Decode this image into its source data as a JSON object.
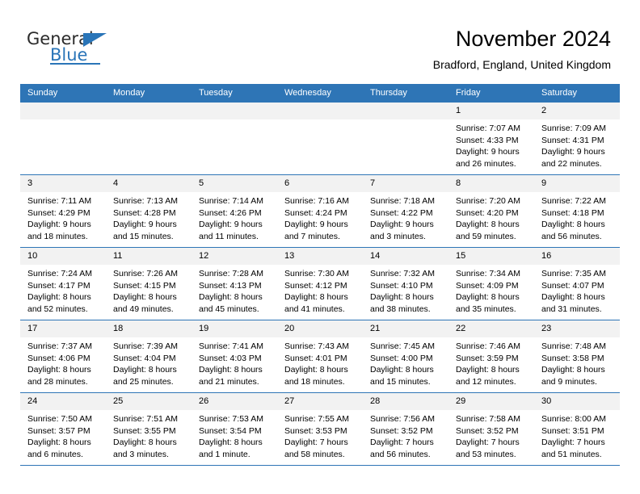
{
  "brand": {
    "name_top": "General",
    "name_bottom": "Blue",
    "accent_color": "#2a75b8"
  },
  "header": {
    "title": "November 2024",
    "subtitle": "Bradford, England, United Kingdom"
  },
  "calendar": {
    "header_bg": "#2e75b6",
    "daynum_bg": "#f2f2f2",
    "weekday_headers": [
      "Sunday",
      "Monday",
      "Tuesday",
      "Wednesday",
      "Thursday",
      "Friday",
      "Saturday"
    ],
    "weeks": [
      [
        {
          "day": "",
          "empty": true
        },
        {
          "day": "",
          "empty": true
        },
        {
          "day": "",
          "empty": true
        },
        {
          "day": "",
          "empty": true
        },
        {
          "day": "",
          "empty": true
        },
        {
          "day": "1",
          "sunrise": "Sunrise: 7:07 AM",
          "sunset": "Sunset: 4:33 PM",
          "daylight": "Daylight: 9 hours and 26 minutes."
        },
        {
          "day": "2",
          "sunrise": "Sunrise: 7:09 AM",
          "sunset": "Sunset: 4:31 PM",
          "daylight": "Daylight: 9 hours and 22 minutes."
        }
      ],
      [
        {
          "day": "3",
          "sunrise": "Sunrise: 7:11 AM",
          "sunset": "Sunset: 4:29 PM",
          "daylight": "Daylight: 9 hours and 18 minutes."
        },
        {
          "day": "4",
          "sunrise": "Sunrise: 7:13 AM",
          "sunset": "Sunset: 4:28 PM",
          "daylight": "Daylight: 9 hours and 15 minutes."
        },
        {
          "day": "5",
          "sunrise": "Sunrise: 7:14 AM",
          "sunset": "Sunset: 4:26 PM",
          "daylight": "Daylight: 9 hours and 11 minutes."
        },
        {
          "day": "6",
          "sunrise": "Sunrise: 7:16 AM",
          "sunset": "Sunset: 4:24 PM",
          "daylight": "Daylight: 9 hours and 7 minutes."
        },
        {
          "day": "7",
          "sunrise": "Sunrise: 7:18 AM",
          "sunset": "Sunset: 4:22 PM",
          "daylight": "Daylight: 9 hours and 3 minutes."
        },
        {
          "day": "8",
          "sunrise": "Sunrise: 7:20 AM",
          "sunset": "Sunset: 4:20 PM",
          "daylight": "Daylight: 8 hours and 59 minutes."
        },
        {
          "day": "9",
          "sunrise": "Sunrise: 7:22 AM",
          "sunset": "Sunset: 4:18 PM",
          "daylight": "Daylight: 8 hours and 56 minutes."
        }
      ],
      [
        {
          "day": "10",
          "sunrise": "Sunrise: 7:24 AM",
          "sunset": "Sunset: 4:17 PM",
          "daylight": "Daylight: 8 hours and 52 minutes."
        },
        {
          "day": "11",
          "sunrise": "Sunrise: 7:26 AM",
          "sunset": "Sunset: 4:15 PM",
          "daylight": "Daylight: 8 hours and 49 minutes."
        },
        {
          "day": "12",
          "sunrise": "Sunrise: 7:28 AM",
          "sunset": "Sunset: 4:13 PM",
          "daylight": "Daylight: 8 hours and 45 minutes."
        },
        {
          "day": "13",
          "sunrise": "Sunrise: 7:30 AM",
          "sunset": "Sunset: 4:12 PM",
          "daylight": "Daylight: 8 hours and 41 minutes."
        },
        {
          "day": "14",
          "sunrise": "Sunrise: 7:32 AM",
          "sunset": "Sunset: 4:10 PM",
          "daylight": "Daylight: 8 hours and 38 minutes."
        },
        {
          "day": "15",
          "sunrise": "Sunrise: 7:34 AM",
          "sunset": "Sunset: 4:09 PM",
          "daylight": "Daylight: 8 hours and 35 minutes."
        },
        {
          "day": "16",
          "sunrise": "Sunrise: 7:35 AM",
          "sunset": "Sunset: 4:07 PM",
          "daylight": "Daylight: 8 hours and 31 minutes."
        }
      ],
      [
        {
          "day": "17",
          "sunrise": "Sunrise: 7:37 AM",
          "sunset": "Sunset: 4:06 PM",
          "daylight": "Daylight: 8 hours and 28 minutes."
        },
        {
          "day": "18",
          "sunrise": "Sunrise: 7:39 AM",
          "sunset": "Sunset: 4:04 PM",
          "daylight": "Daylight: 8 hours and 25 minutes."
        },
        {
          "day": "19",
          "sunrise": "Sunrise: 7:41 AM",
          "sunset": "Sunset: 4:03 PM",
          "daylight": "Daylight: 8 hours and 21 minutes."
        },
        {
          "day": "20",
          "sunrise": "Sunrise: 7:43 AM",
          "sunset": "Sunset: 4:01 PM",
          "daylight": "Daylight: 8 hours and 18 minutes."
        },
        {
          "day": "21",
          "sunrise": "Sunrise: 7:45 AM",
          "sunset": "Sunset: 4:00 PM",
          "daylight": "Daylight: 8 hours and 15 minutes."
        },
        {
          "day": "22",
          "sunrise": "Sunrise: 7:46 AM",
          "sunset": "Sunset: 3:59 PM",
          "daylight": "Daylight: 8 hours and 12 minutes."
        },
        {
          "day": "23",
          "sunrise": "Sunrise: 7:48 AM",
          "sunset": "Sunset: 3:58 PM",
          "daylight": "Daylight: 8 hours and 9 minutes."
        }
      ],
      [
        {
          "day": "24",
          "sunrise": "Sunrise: 7:50 AM",
          "sunset": "Sunset: 3:57 PM",
          "daylight": "Daylight: 8 hours and 6 minutes."
        },
        {
          "day": "25",
          "sunrise": "Sunrise: 7:51 AM",
          "sunset": "Sunset: 3:55 PM",
          "daylight": "Daylight: 8 hours and 3 minutes."
        },
        {
          "day": "26",
          "sunrise": "Sunrise: 7:53 AM",
          "sunset": "Sunset: 3:54 PM",
          "daylight": "Daylight: 8 hours and 1 minute."
        },
        {
          "day": "27",
          "sunrise": "Sunrise: 7:55 AM",
          "sunset": "Sunset: 3:53 PM",
          "daylight": "Daylight: 7 hours and 58 minutes."
        },
        {
          "day": "28",
          "sunrise": "Sunrise: 7:56 AM",
          "sunset": "Sunset: 3:52 PM",
          "daylight": "Daylight: 7 hours and 56 minutes."
        },
        {
          "day": "29",
          "sunrise": "Sunrise: 7:58 AM",
          "sunset": "Sunset: 3:52 PM",
          "daylight": "Daylight: 7 hours and 53 minutes."
        },
        {
          "day": "30",
          "sunrise": "Sunrise: 8:00 AM",
          "sunset": "Sunset: 3:51 PM",
          "daylight": "Daylight: 7 hours and 51 minutes."
        }
      ]
    ]
  }
}
